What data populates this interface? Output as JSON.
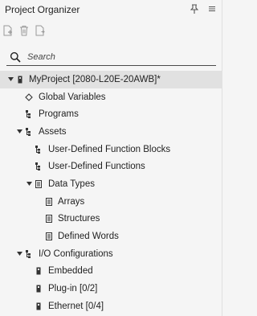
{
  "panel": {
    "title": "Project Organizer"
  },
  "title_icons": [
    "pin-icon",
    "menu-icon"
  ],
  "toolbar": {
    "buttons": [
      "add-item-icon",
      "delete-icon",
      "properties-icon"
    ]
  },
  "search": {
    "placeholder": "Search",
    "value": ""
  },
  "tree": {
    "items": [
      {
        "label": "MyProject [2080-L20E-20AWB]*",
        "icon": "controller-icon",
        "expanded": true,
        "selected": true
      },
      {
        "label": "Global Variables",
        "icon": "tag-icon"
      },
      {
        "label": "Programs",
        "icon": "folder-tree-icon"
      },
      {
        "label": "Assets",
        "icon": "folder-tree-icon",
        "expanded": true
      },
      {
        "label": "User-Defined Function Blocks",
        "icon": "folder-tree-icon"
      },
      {
        "label": "User-Defined Functions",
        "icon": "folder-tree-icon"
      },
      {
        "label": "Data Types",
        "icon": "data-type-icon",
        "expanded": true
      },
      {
        "label": "Arrays",
        "icon": "data-type-icon"
      },
      {
        "label": "Structures",
        "icon": "data-type-icon"
      },
      {
        "label": "Defined Words",
        "icon": "data-type-icon"
      },
      {
        "label": "I/O Configurations",
        "icon": "folder-tree-icon",
        "expanded": true
      },
      {
        "label": "Embedded",
        "icon": "module-icon"
      },
      {
        "label": "Plug-in [0/2]",
        "icon": "module-icon"
      },
      {
        "label": "Ethernet [0/4]",
        "icon": "module-icon"
      }
    ]
  }
}
